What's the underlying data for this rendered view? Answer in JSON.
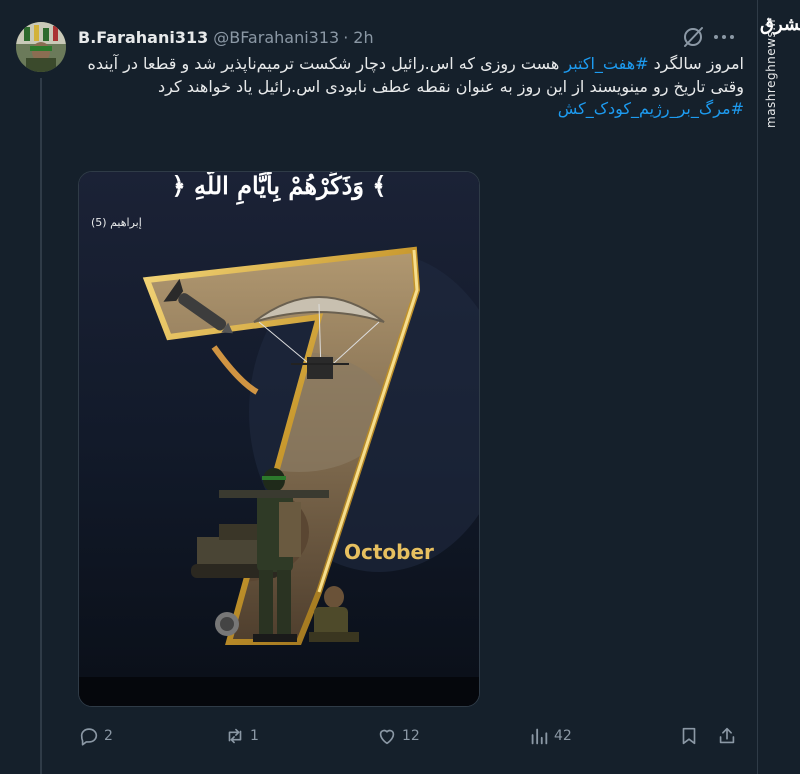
{
  "author": {
    "name": "B.Farahani313",
    "handle": "@BFarahani313",
    "separator": "·",
    "time": "2h"
  },
  "tweet": {
    "line1_pre": "امروز سالگرد ",
    "hashtag1": "#هفت_اکتبر",
    "line1_post": " هست روزی که اس.رائیل دچار شکست ترمیم‌ناپذیر شد و قطعا در آینده وقتی تاریخ رو مینویسند از این روز به عنوان نقطه عطف نابودی اس.رائیل یاد خواهند کرد",
    "hashtag2": "#مرگ_بر_رژیم_کودک_کش"
  },
  "media": {
    "verse": "﴿ وَذَكِّرْهُمْ بِأَيَّامِ اللَّهِ ﴾",
    "verse_ref": "إبراهيم (5)",
    "numeral": "7",
    "month": "October"
  },
  "actions": {
    "replies": "2",
    "reposts": "1",
    "likes": "12",
    "views": "42"
  },
  "watermark": {
    "logo": "مشرق",
    "site": "mashreghnews.ir"
  },
  "icons": {
    "reply": "reply-icon",
    "repost": "repost-icon",
    "like": "heart-icon",
    "views": "views-icon",
    "bookmark": "bookmark-icon",
    "share": "share-icon",
    "grok": "grok-icon",
    "more": "more-icon"
  },
  "colors": {
    "background": "#15202b",
    "hashtag": "#1d9bf0",
    "muted": "#8b98a5",
    "gold": "#d9b04a"
  }
}
